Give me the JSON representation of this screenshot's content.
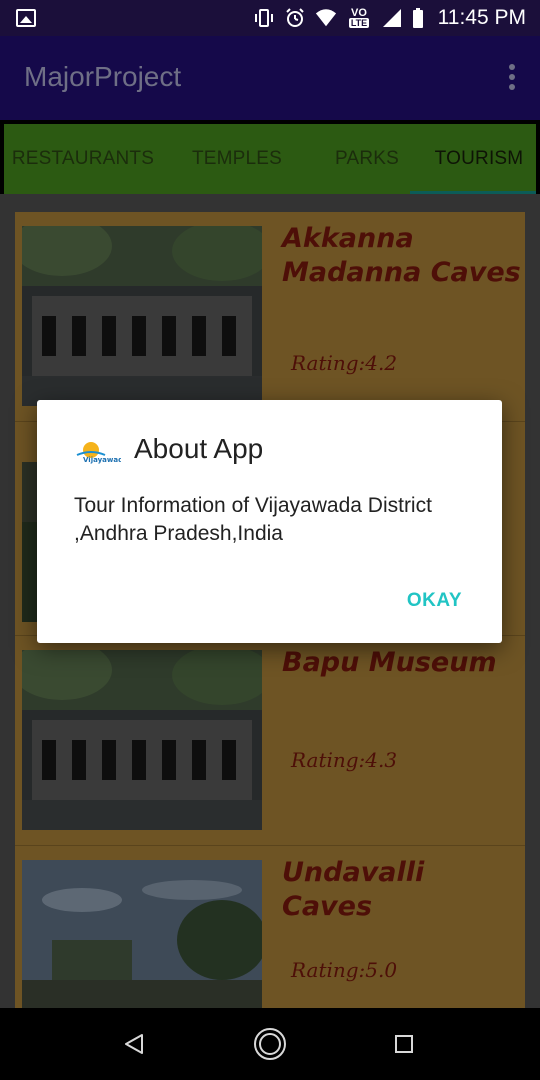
{
  "status_bar": {
    "time": "11:45 PM",
    "icons": [
      "gallery-icon",
      "vibrate-icon",
      "alarm-icon",
      "wifi-icon",
      "volte-icon",
      "signal-icon",
      "battery-icon"
    ],
    "volte_label": "VO",
    "lte_label": "LTE"
  },
  "app_bar": {
    "title": "MajorProject",
    "menu_icon": "overflow-menu-icon"
  },
  "tabs": {
    "items": [
      "RESTAURANTS",
      "TEMPLES",
      "PARKS",
      "TOURISM"
    ],
    "selected": "TOURISM"
  },
  "places": [
    {
      "name": "Akkanna Madanna Caves",
      "rating": "Rating:4.2"
    },
    {
      "name": "",
      "rating": ""
    },
    {
      "name": "Bapu Museum",
      "rating": "Rating:4.3"
    },
    {
      "name": "Undavalli Caves",
      "rating": "Rating:5.0"
    }
  ],
  "dialog": {
    "title": "About App",
    "logo_text": "Vijayawada",
    "message": "Tour Information of Vijayawada District ,Andhra Pradesh,India",
    "ok_label": "OKAY"
  },
  "nav_bar": {
    "back": "back-icon",
    "home": "home-icon",
    "recents": "recents-icon"
  },
  "colors": {
    "status_bar": "#1b0f3a",
    "app_bar": "#15094a",
    "tab_bar": "#2c5a12",
    "card_bg": "#6e5424",
    "place_text": "#4e0f08",
    "dialog_accent": "#21c4c4"
  }
}
